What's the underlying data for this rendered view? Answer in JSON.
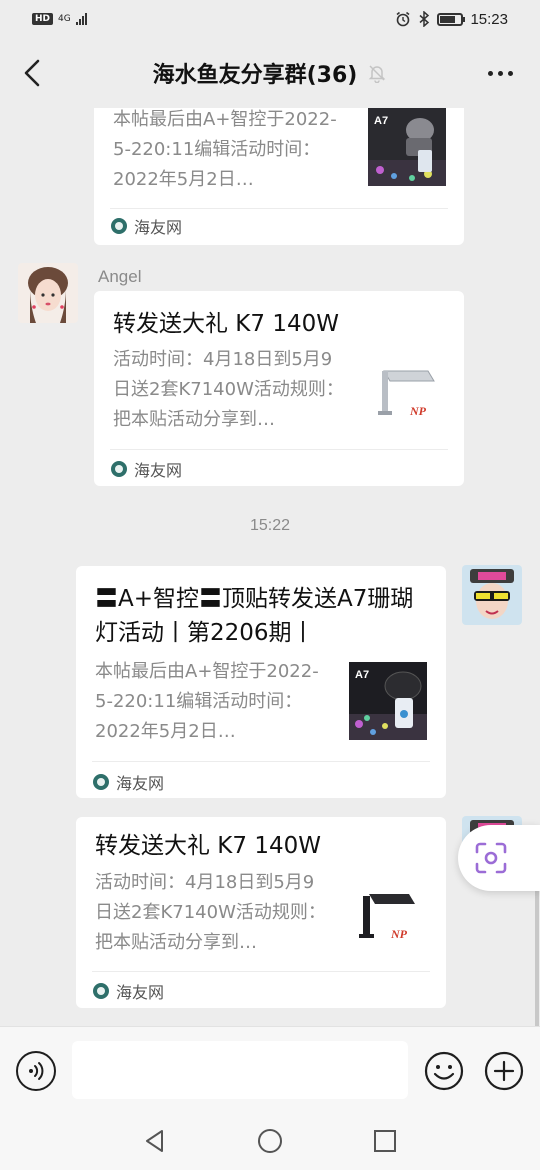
{
  "status_bar": {
    "hd": "HD",
    "network": "4G",
    "time": "15:23",
    "battery_level": 0.75
  },
  "header": {
    "title": "海水鱼友分享群(36)"
  },
  "messages": [
    {
      "title": "",
      "desc": "本帖最后由A+智控于2022-5-220:11编辑活动时间：2022年5月2日…",
      "thumb_label": "A7",
      "source": "海友网"
    },
    {
      "sender": "Angel",
      "title": "转发送大礼 K7 140W",
      "desc": "活动时间：4月18日到5月9日送2套K7140W活动规则：把本贴活动分享到…",
      "source": "海友网"
    },
    {
      "time": "15:22"
    },
    {
      "title": "〓A+智控〓顶贴转发送A7珊瑚灯活动丨第2206期丨",
      "desc": "本帖最后由A+智控于2022-5-220:11编辑活动时间：2022年5月2日…",
      "thumb_label": "A7",
      "source": "海友网"
    },
    {
      "title": "转发送大礼 K7 140W",
      "desc": "活动时间：4月18日到5月9日送2套K7140W活动规则：把本贴活动分享到…",
      "source": "海友网"
    }
  ],
  "input": {
    "placeholder": ""
  },
  "colors": {
    "background": "#ededed",
    "card": "#ffffff",
    "source_icon": "#2e6f6a",
    "muted_text": "#8a8a8a",
    "accent_purple": "#9b6cd6"
  }
}
